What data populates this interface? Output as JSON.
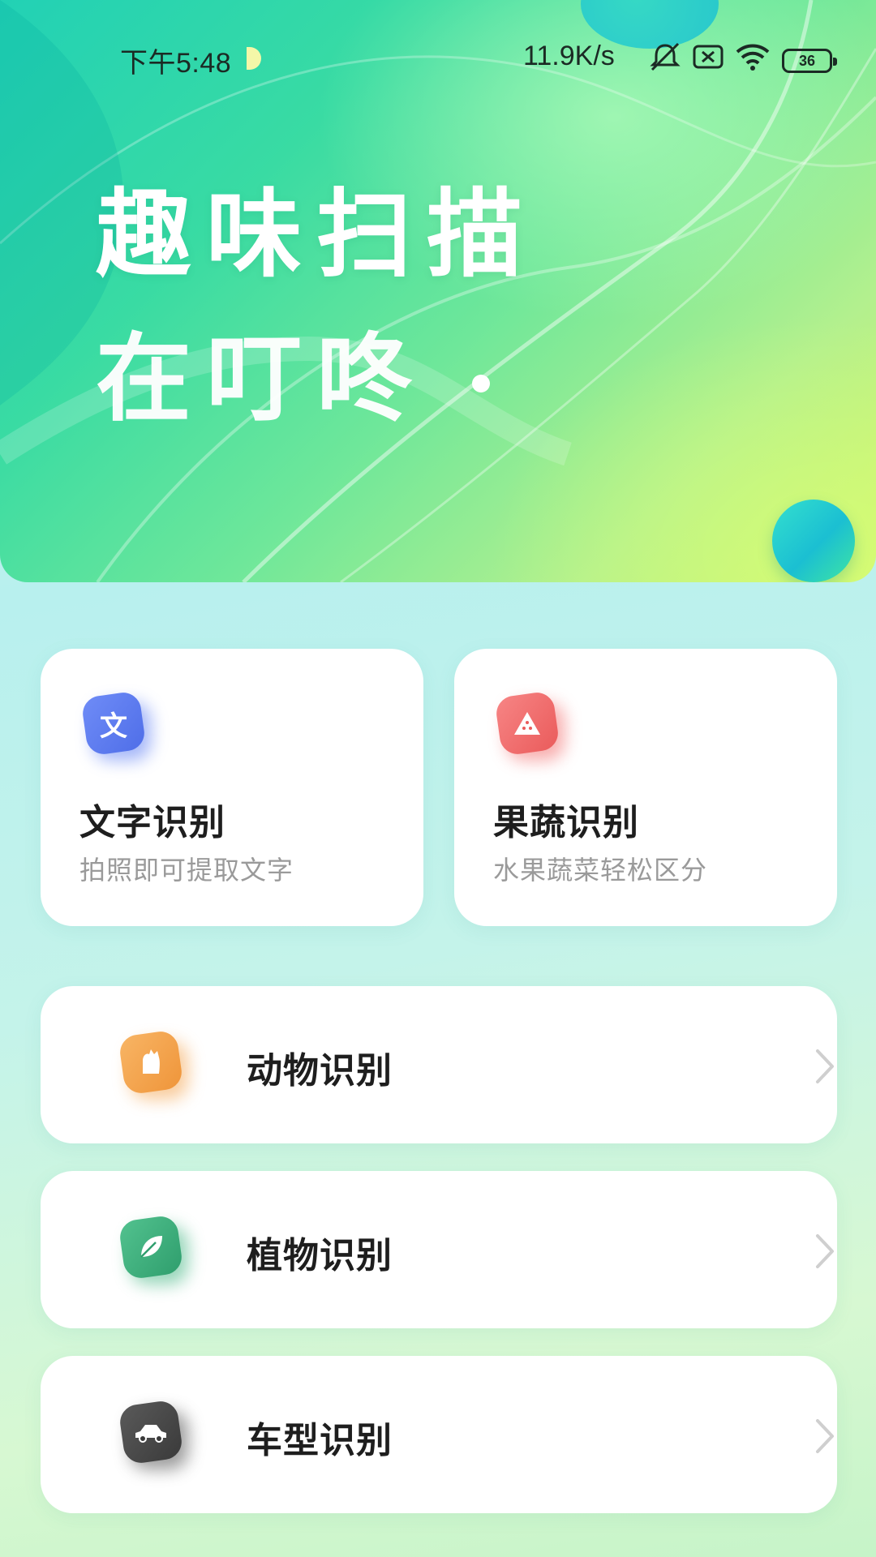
{
  "status_bar": {
    "time": "下午5:48",
    "net_speed": "11.9K/s",
    "battery": "36",
    "icons": [
      "mute-icon",
      "sim-x-icon",
      "wifi-icon",
      "battery-icon"
    ]
  },
  "hero": {
    "title": "趣味扫描",
    "subtitle": "在叮咚"
  },
  "features": [
    {
      "title": "文字识别",
      "desc": "拍照即可提取文字",
      "icon": "text-recognition-icon",
      "icon_glyph": "文",
      "color": "#5b7cf3"
    },
    {
      "title": "果蔬识别",
      "desc": "水果蔬菜轻松区分",
      "icon": "fruit-icon",
      "color": "#f26b6b"
    }
  ],
  "list": [
    {
      "label": "动物识别",
      "icon": "animal-icon",
      "color": "#f4a34d"
    },
    {
      "label": "植物识别",
      "icon": "leaf-icon",
      "color": "#3fb37f"
    },
    {
      "label": "车型识别",
      "icon": "car-icon",
      "color": "#4a4a4a"
    }
  ]
}
